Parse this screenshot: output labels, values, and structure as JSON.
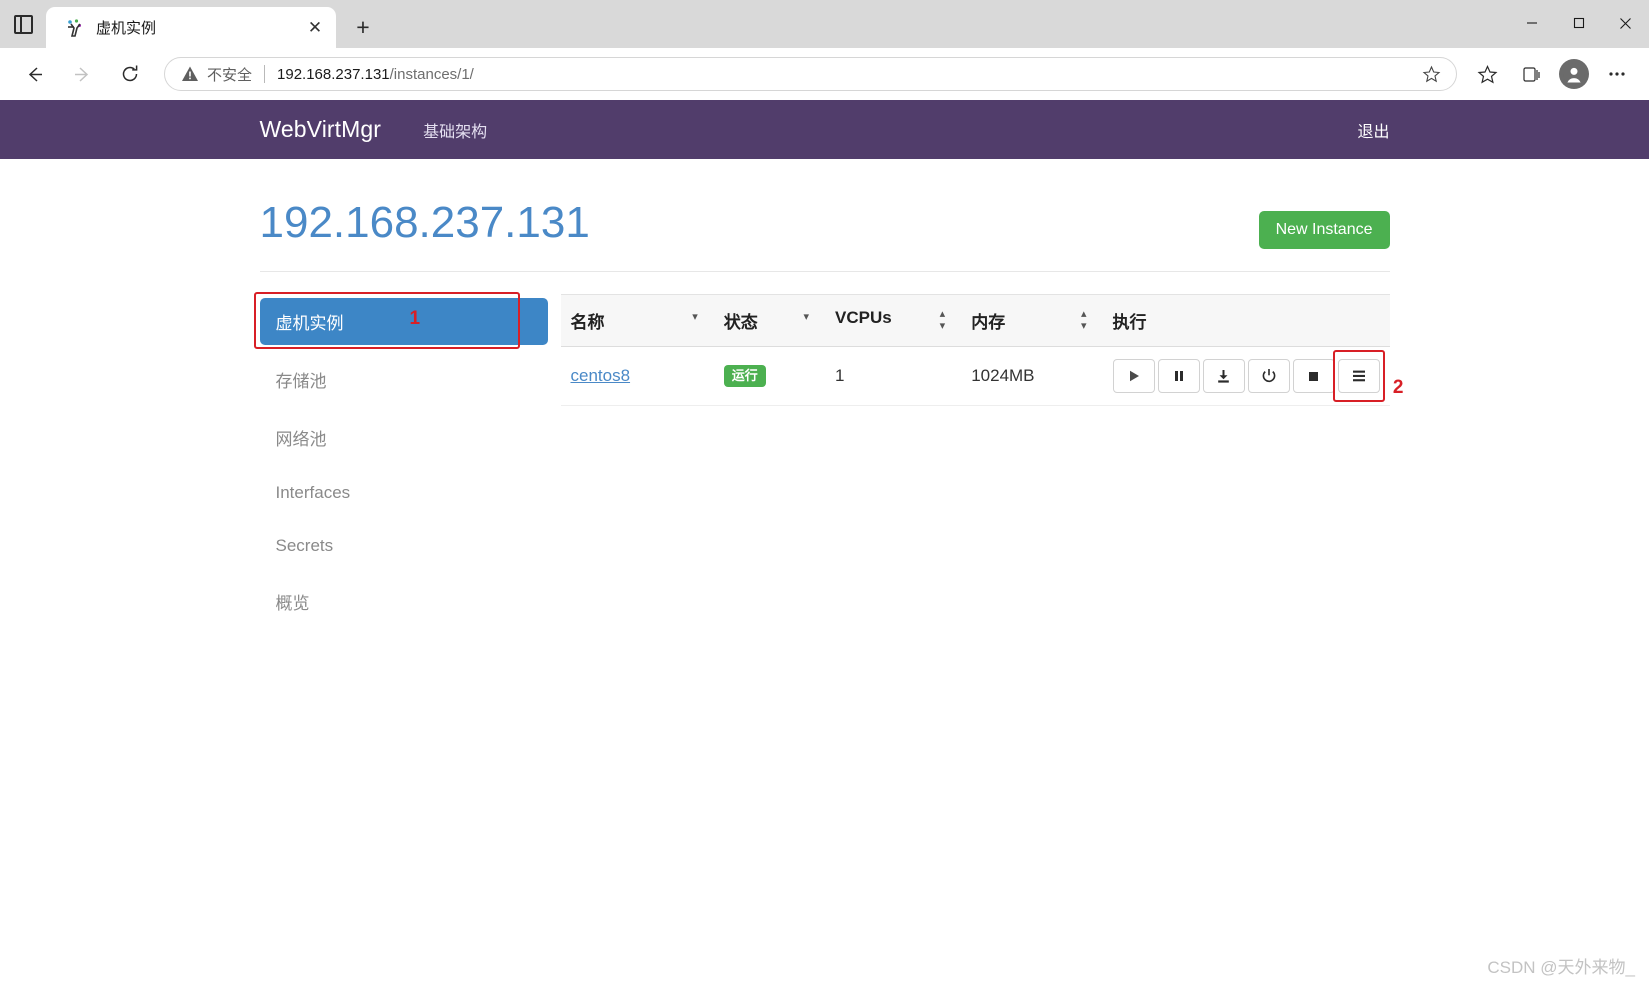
{
  "browser": {
    "tab": {
      "title": "虚机实例",
      "favicon_name": "webvirtmgr-favicon",
      "close_label": "✕"
    },
    "newtab_label": "+",
    "window_controls": {
      "minimize": "minimize-icon",
      "maximize": "maximize-icon",
      "close": "close-icon"
    },
    "toolbar": {
      "back": "back-arrow-icon",
      "forward": "forward-arrow-icon",
      "reload": "reload-icon",
      "security_text": "不安全",
      "url_host": "192.168.237.131",
      "url_path": "/instances/1/",
      "favorite": "add-favorite-icon",
      "collections": "collections-icon",
      "favorites_bar": "favorites-icon",
      "profile": "profile-avatar",
      "settings": "more-options-icon"
    }
  },
  "navbar": {
    "brand": "WebVirtMgr",
    "links": [
      {
        "label": "基础架构"
      }
    ],
    "logout": "退出",
    "background": "#513d6b"
  },
  "header": {
    "title": "192.168.237.131",
    "new_instance_label": "New Instance",
    "new_instance_color": "#4cb050"
  },
  "sidebar": {
    "items": [
      {
        "label": "虚机实例",
        "active": true
      },
      {
        "label": "存储池",
        "active": false
      },
      {
        "label": "网络池",
        "active": false
      },
      {
        "label": "Interfaces",
        "active": false
      },
      {
        "label": "Secrets",
        "active": false
      },
      {
        "label": "概览",
        "active": false
      }
    ]
  },
  "table": {
    "columns": [
      {
        "label": "名称",
        "sort": "desc"
      },
      {
        "label": "状态",
        "sort": "desc"
      },
      {
        "label": "VCPUs",
        "sort": "both"
      },
      {
        "label": "内存",
        "sort": "both"
      },
      {
        "label": "执行",
        "sort": "none"
      }
    ],
    "rows": [
      {
        "name": "centos8",
        "status": "运行",
        "status_color": "#4cb050",
        "vcpus": "1",
        "memory": "1024MB",
        "actions": [
          {
            "name": "start-button",
            "icon": "play-icon"
          },
          {
            "name": "pause-button",
            "icon": "pause-icon"
          },
          {
            "name": "suspend-button",
            "icon": "download-icon"
          },
          {
            "name": "poweroff-button",
            "icon": "power-icon"
          },
          {
            "name": "forceoff-button",
            "icon": "stop-icon"
          },
          {
            "name": "console-menu-button",
            "icon": "hamburger-icon"
          }
        ]
      }
    ]
  },
  "annotations": [
    {
      "id": "1",
      "target": "sidebar-instances",
      "color": "#d81f26"
    },
    {
      "id": "2",
      "target": "console-menu-button",
      "color": "#d81f26"
    }
  ],
  "watermark": "CSDN @天外来物_"
}
